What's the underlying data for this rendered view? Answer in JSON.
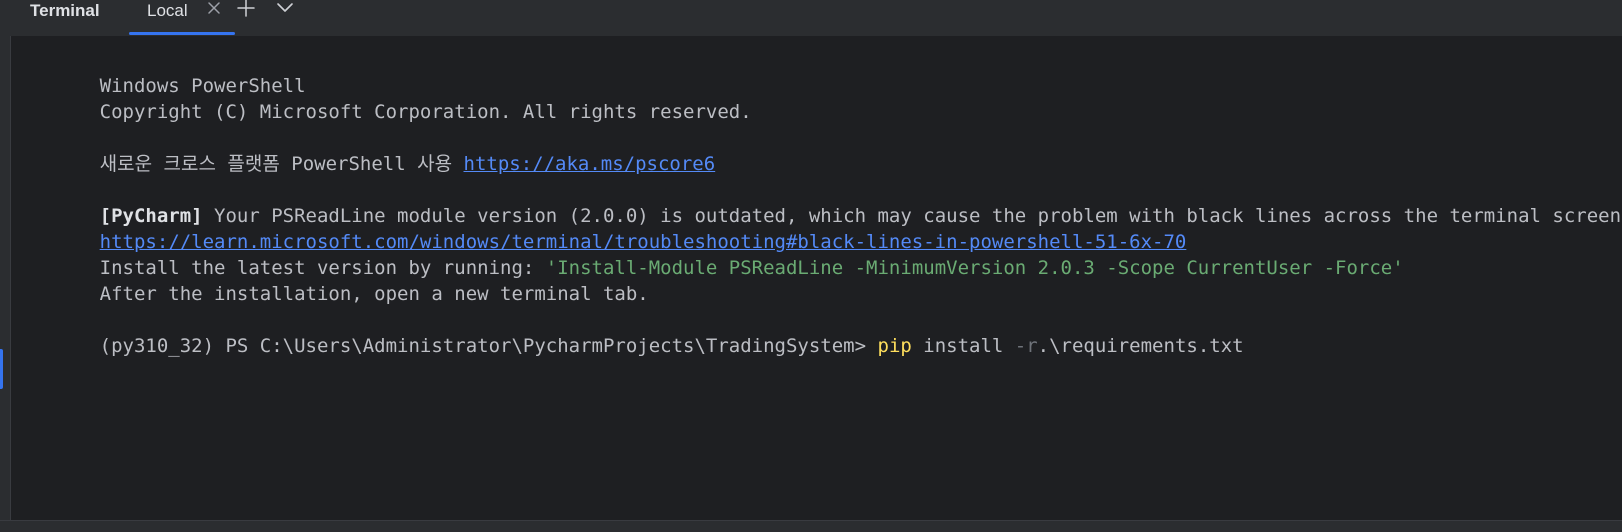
{
  "header": {
    "title": "Terminal",
    "tabs": [
      {
        "label": "Local",
        "active": true
      }
    ],
    "icons": {
      "close": "close-icon",
      "new_tab": "plus-icon",
      "more": "chevron-down-icon"
    }
  },
  "terminal": {
    "lines": {
      "l1": "Windows PowerShell",
      "l2": "Copyright (C) Microsoft Corporation. All rights reserved.",
      "l3_text": "새로운 크로스 플랫폼 PowerShell 사용 ",
      "l3_link": "https://aka.ms/pscore6",
      "l4_tag": "[PyCharm]",
      "l4_text": " Your PSReadLine module version (2.0.0) is outdated, which may cause the problem with black lines across the terminal screen",
      "l5_link": "https://learn.microsoft.com/windows/terminal/troubleshooting#black-lines-in-powershell-51-6x-70",
      "l6_text": "Install the latest version by running: ",
      "l6_cmd": "'Install-Module PSReadLine -MinimumVersion 2.0.3 -Scope CurrentUser -Force'",
      "l7": "After the installation, open a new terminal tab.",
      "prompt": "(py310_32) PS C:\\Users\\Administrator\\PycharmProjects\\TradingSystem> ",
      "input_cmd": "pip",
      "input_mid": " install ",
      "input_param": "-r",
      "input_arg": ".\\requirements.txt"
    }
  },
  "colors": {
    "background": "#1e1f22",
    "panel": "#2b2d30",
    "text": "#bcbec4",
    "link": "#548af7",
    "string": "#6aab73",
    "command": "#fede5d",
    "accent": "#3574f0"
  }
}
